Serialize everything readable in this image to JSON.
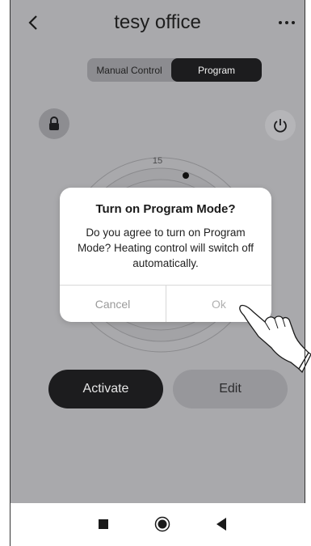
{
  "header": {
    "back_glyph": "‹",
    "title": "tesy office",
    "more_glyph": "•••"
  },
  "mode_toggle": {
    "manual_label": "Manual Control",
    "program_label": "Program",
    "selected": "Program"
  },
  "icons": {
    "lock": "lock-icon",
    "power": "power-icon"
  },
  "dial": {
    "top_value": "15"
  },
  "actions": {
    "activate_label": "Activate",
    "edit_label": "Edit"
  },
  "dialog": {
    "title": "Turn on Program Mode?",
    "message": "Do you agree to turn on Program Mode? Heating control will switch off automatically.",
    "cancel_label": "Cancel",
    "ok_label": "Ok"
  },
  "colors": {
    "overlay_bg": "#a9a9ac",
    "dark_button": "#1c1c1e",
    "dialog_bg": "#ffffff"
  }
}
